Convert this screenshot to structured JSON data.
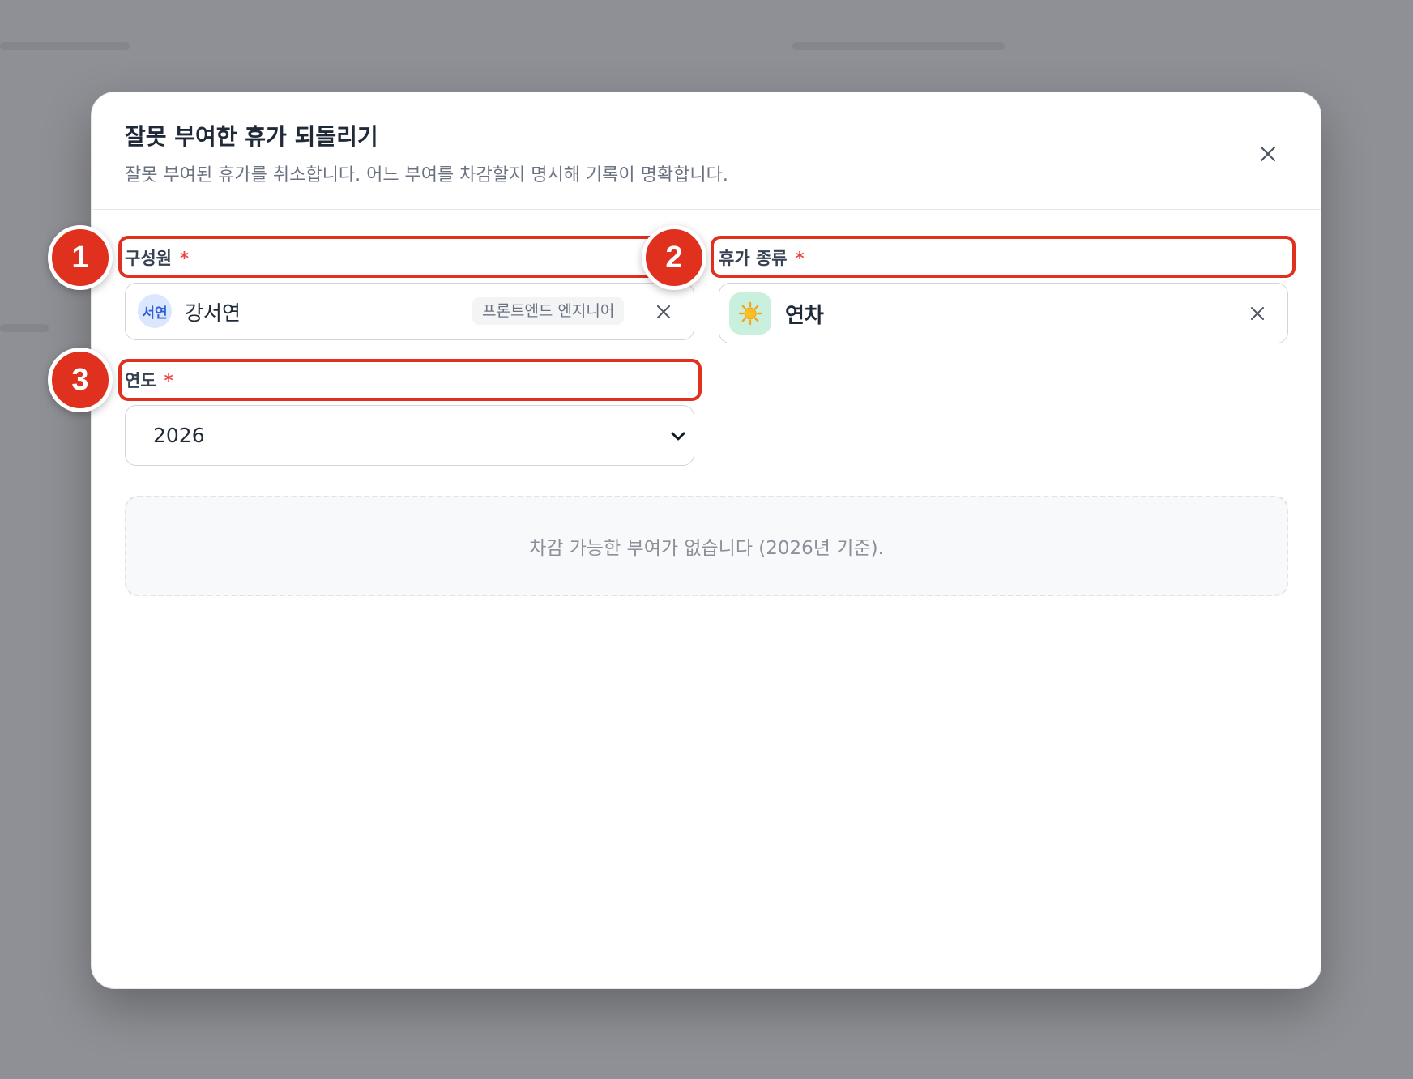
{
  "dialog": {
    "title": "잘못 부여한 휴가 되돌리기",
    "subtitle": "잘못 부여된 휴가를 취소합니다. 어느 부여를 차감할지 명시해 기록이 명확합니다."
  },
  "form": {
    "member": {
      "label": "구성원",
      "required_mark": "*",
      "avatar_initials": "서연",
      "name": "강서연",
      "role": "프론트엔드 엔지니어"
    },
    "leave_type": {
      "label": "휴가 종류",
      "required_mark": "*",
      "icon": "sun-icon",
      "value": "연차"
    },
    "year": {
      "label": "연도",
      "required_mark": "*",
      "selected": "2026"
    }
  },
  "empty_state": {
    "message": "차감 가능한 부여가 없습니다 (2026년 기준)."
  },
  "annotations": {
    "steps": [
      "1",
      "2",
      "3"
    ],
    "color": "#e0301e"
  },
  "colors": {
    "overlay": "#8f9095",
    "required": "#ef4444",
    "avatar_bg": "#dbe6ff",
    "avatar_text": "#2f5fd6",
    "leave_icon_bg": "#c9f0dc"
  }
}
